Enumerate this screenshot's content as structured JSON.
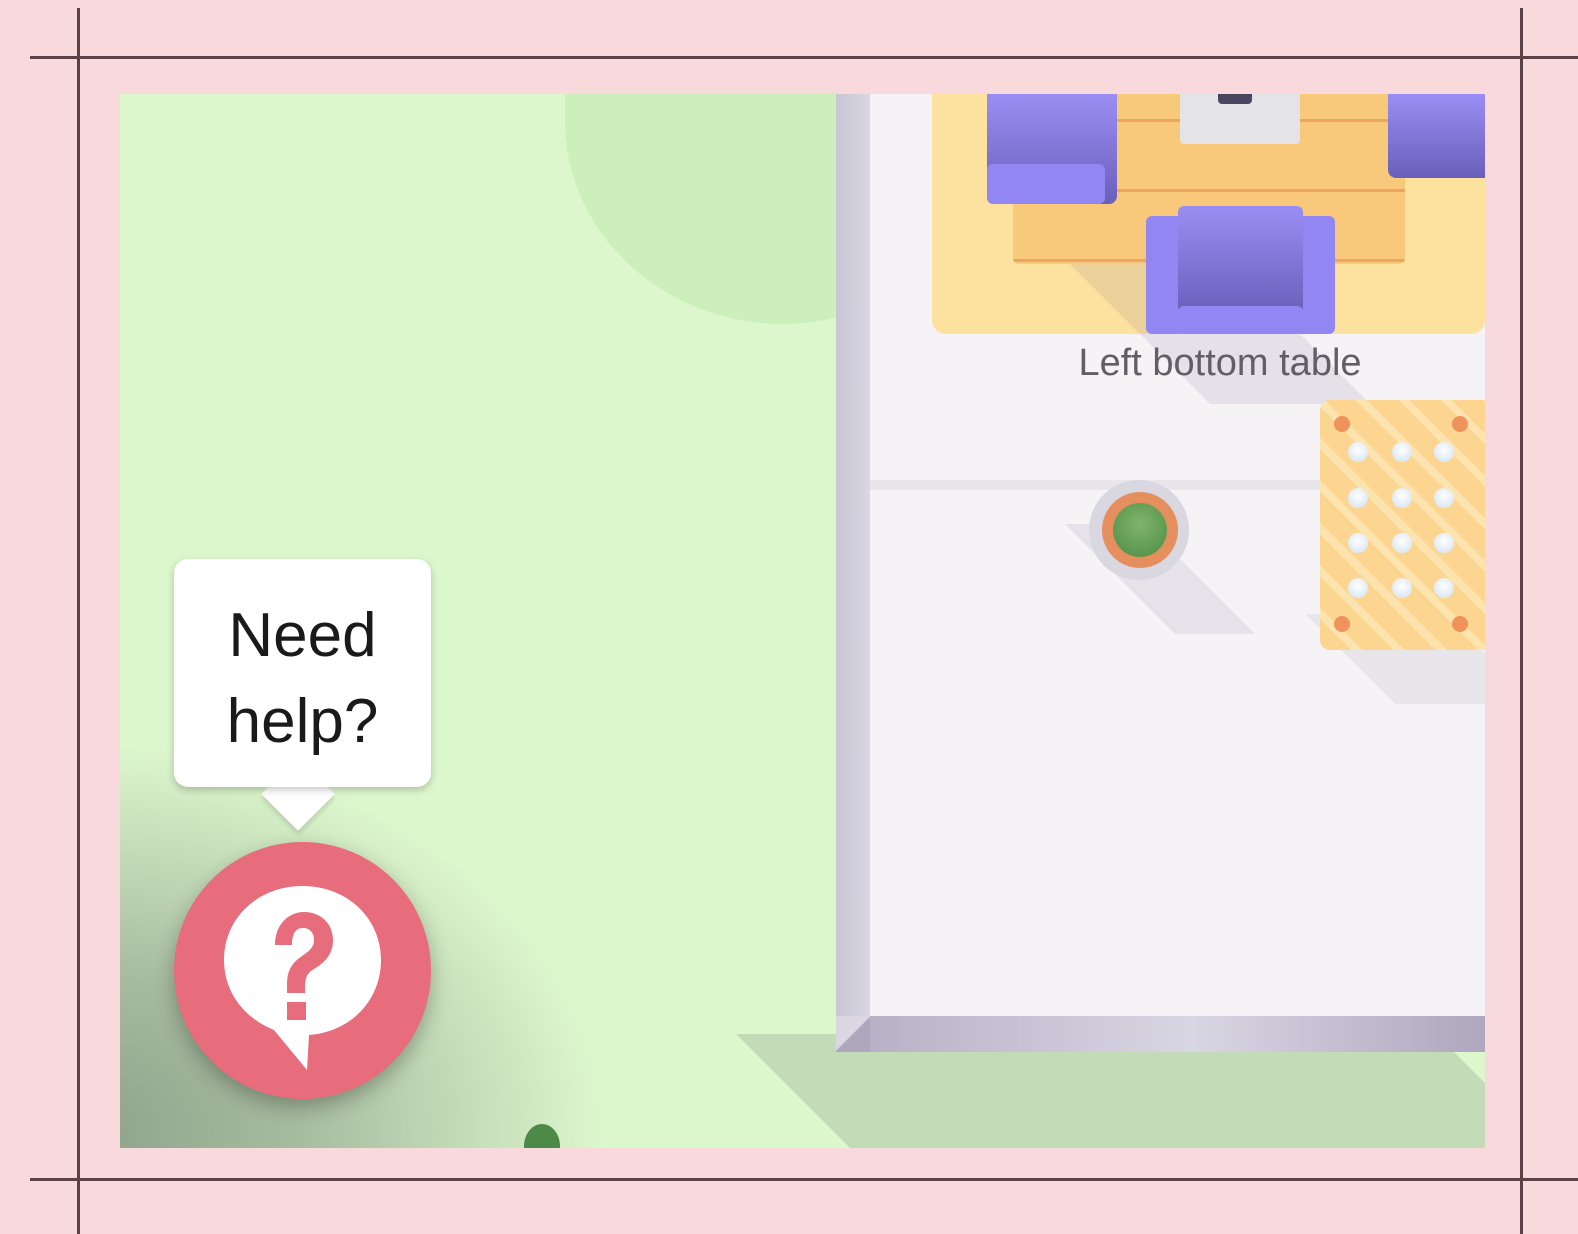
{
  "scene": {
    "table_label": "Left bottom table",
    "furniture": [
      "table-icon",
      "armchair-icon",
      "device-icon",
      "plant-icon",
      "floor-pad-icon"
    ]
  },
  "help": {
    "tooltip_text": "Need help?",
    "button_icon": "help-chat-icon",
    "accent_color": "#e86d7c"
  },
  "colors": {
    "background": "#f8d9dc",
    "lawn": "#ddf7cd",
    "floor": "#f5f3f6",
    "table_zone": "#fde19e",
    "chair": "#9287f2"
  }
}
